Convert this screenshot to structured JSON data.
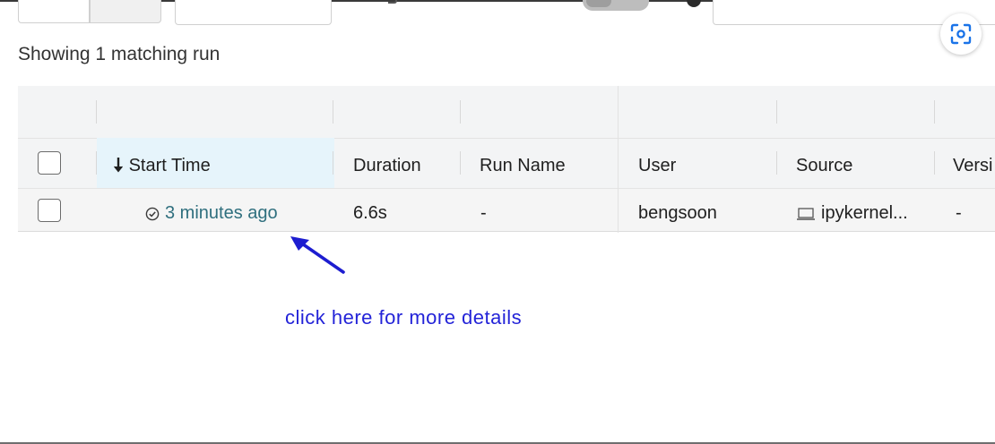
{
  "results": {
    "summary": "Showing 1 matching run"
  },
  "table": {
    "columns": {
      "start_time": "Start Time",
      "duration": "Duration",
      "run_name": "Run Name",
      "user": "User",
      "source": "Source",
      "version": "Versi"
    },
    "sort_icon": "arrow-down-icon",
    "rows": [
      {
        "start_time": "3 minutes ago",
        "status_icon": "check-circle-icon",
        "duration": "6.6s",
        "run_name": "-",
        "user": "bengsoon",
        "source_icon": "laptop-icon",
        "source": "ipykernel...",
        "version": "-"
      }
    ]
  },
  "annotation": {
    "text": "click here for more details",
    "color": "#2323d8"
  },
  "colors": {
    "link": "#2f6f7e",
    "sorted_column_bg": "#e6f4fb"
  }
}
